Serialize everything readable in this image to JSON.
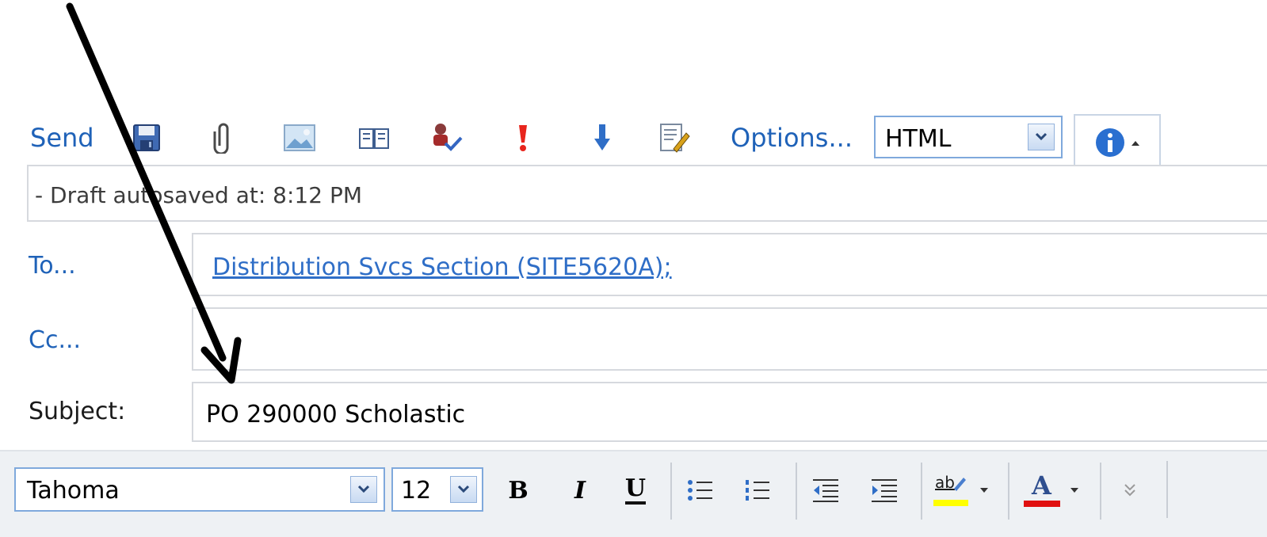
{
  "toolbar": {
    "send_label": "Send",
    "options_label": "Options...",
    "icons": [
      "save-icon",
      "attach-icon",
      "insert-picture-icon",
      "address-book-icon",
      "check-names-icon",
      "high-importance-icon",
      "low-importance-icon",
      "signature-icon",
      "info-icon"
    ],
    "format_value": "HTML"
  },
  "draft": {
    "text": "- Draft autosaved at: 8:12 PM"
  },
  "to": {
    "label": "To...",
    "recipient": "Distribution Svcs Section (SITE5620A);"
  },
  "cc": {
    "label": "Cc...",
    "value": ""
  },
  "subject": {
    "label": "Subject:",
    "value": "PO 290000 Scholastic"
  },
  "formatting": {
    "font": "Tahoma",
    "size": "12",
    "bold": "B",
    "italic": "I",
    "underline": "U",
    "highlight_text": "ab",
    "font_color_letter": "A"
  },
  "colors": {
    "link_blue": "#1f62b8",
    "field_border": "#d6d9de",
    "highlight": "#ffff00",
    "font_color": "#e01010",
    "arrow": "#000000"
  }
}
